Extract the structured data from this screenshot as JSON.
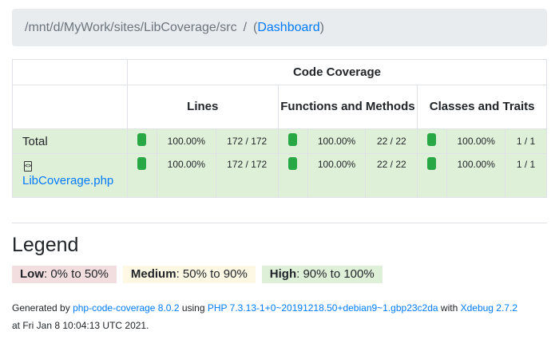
{
  "breadcrumb": {
    "path": "/mnt/d/MyWork/sites/LibCoverage/src",
    "separator": "/",
    "open_paren": "(",
    "dashboard_link": "Dashboard",
    "close_paren": ")"
  },
  "table": {
    "group_header": "Code Coverage",
    "columns": [
      "Lines",
      "Functions and Methods",
      "Classes and Traits"
    ],
    "rows": [
      {
        "name": "Total",
        "is_link": false,
        "lines_pct": "100.00%",
        "lines_frac": "172 / 172",
        "funcs_pct": "100.00%",
        "funcs_frac": "22 / 22",
        "classes_pct": "100.00%",
        "classes_frac": "1 / 1"
      },
      {
        "name": "LibCoverage.php",
        "is_link": true,
        "icon": "php-file-icon",
        "lines_pct": "100.00%",
        "lines_frac": "172 / 172",
        "funcs_pct": "100.00%",
        "funcs_frac": "22 / 22",
        "classes_pct": "100.00%",
        "classes_frac": "1 / 1"
      }
    ],
    "bar_color": "#28a745",
    "row_color": "#dff0d8"
  },
  "legend": {
    "title": "Legend",
    "low_label": "Low",
    "low_range": ": 0% to 50%",
    "medium_label": "Medium",
    "medium_range": ": 50% to 90%",
    "high_label": "High",
    "high_range": ": 90% to 100%"
  },
  "footer": {
    "generated_by": "Generated by ",
    "tool_link": "php-code-coverage 8.0.2",
    "using": " using ",
    "php_link": "PHP 7.3.13-1+0~20191218.50+debian9~1.gbp23c2da",
    "with": " with ",
    "xdebug_link": "Xdebug 2.7.2",
    "at": "at Fri Jan 8 10:04:13 UTC 2021."
  }
}
